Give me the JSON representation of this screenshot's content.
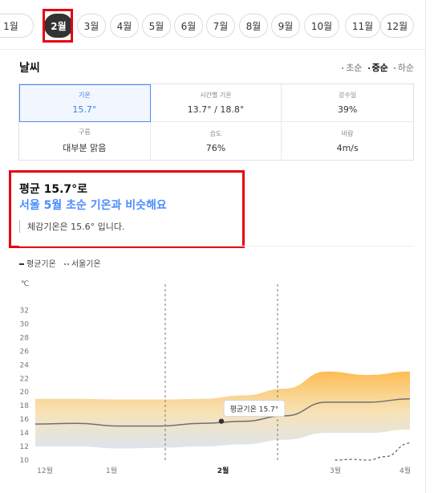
{
  "months": [
    {
      "label": "1월",
      "active": false
    },
    {
      "label": "2월",
      "active": true
    },
    {
      "label": "3월",
      "active": false
    },
    {
      "label": "4월",
      "active": false
    },
    {
      "label": "5월",
      "active": false
    },
    {
      "label": "6월",
      "active": false
    },
    {
      "label": "7월",
      "active": false
    },
    {
      "label": "8월",
      "active": false
    },
    {
      "label": "9월",
      "active": false
    },
    {
      "label": "10월",
      "active": false
    },
    {
      "label": "11월",
      "active": false
    },
    {
      "label": "12월",
      "active": false
    }
  ],
  "weather": {
    "title": "날씨",
    "periods": [
      "초순",
      "중순",
      "하순"
    ],
    "active_period": "중순",
    "stats": [
      {
        "label": "기온",
        "value": "15.7°",
        "selected": true
      },
      {
        "label": "시간별 기온",
        "value": "13.7° / 18.8°",
        "selected": false
      },
      {
        "label": "강수일",
        "value": "39%",
        "selected": false
      },
      {
        "label": "구름",
        "value": "대부분 맑음",
        "selected": false
      },
      {
        "label": "습도",
        "value": "76%",
        "selected": false
      },
      {
        "label": "바람",
        "value": "4m/s",
        "selected": false
      }
    ]
  },
  "summary": {
    "main": "평균 15.7°로",
    "sub": "서울 5월 초순 기온과 비슷해요",
    "feel": "체감기온은 15.6° 입니다."
  },
  "legend": {
    "avg": "평균기온",
    "seoul": "서울기온"
  },
  "colors": {
    "accent": "#4a8cff",
    "highlight": "#e60012",
    "band_top": "#ffb848",
    "band_bottom": "#c8d3e0"
  },
  "chart_data": {
    "type": "area",
    "ylabel": "℃",
    "ylim": [
      10,
      33
    ],
    "yticks": [
      10,
      12,
      14,
      16,
      18,
      20,
      22,
      24,
      26,
      28,
      30,
      32
    ],
    "xticks": [
      "12월",
      "1월",
      "2월",
      "3월",
      "4월"
    ],
    "highlight_x": "2월",
    "series": [
      {
        "name": "평균기온",
        "x": [
          0,
          0.5,
          1,
          1.5,
          2,
          2.5,
          3,
          3.5,
          4,
          4.5
        ],
        "values": [
          15.3,
          15.4,
          15.0,
          15.0,
          15.4,
          15.7,
          16.5,
          18.5,
          18.5,
          19.0
        ]
      },
      {
        "name": "서울기온",
        "x": [
          3.6,
          3.8,
          4.0,
          4.2,
          4.5
        ],
        "values": [
          10.0,
          10.1,
          10.0,
          10.5,
          12.5
        ]
      }
    ],
    "band": {
      "upper": [
        19.0,
        19.0,
        18.9,
        18.9,
        19.0,
        19.5,
        20.5,
        23.0,
        22.5,
        23.0
      ],
      "lower": [
        12.0,
        12.0,
        11.7,
        11.8,
        12.0,
        12.3,
        13.0,
        14.0,
        14.0,
        14.5
      ]
    },
    "tooltip": "평균기온 15.7°"
  }
}
